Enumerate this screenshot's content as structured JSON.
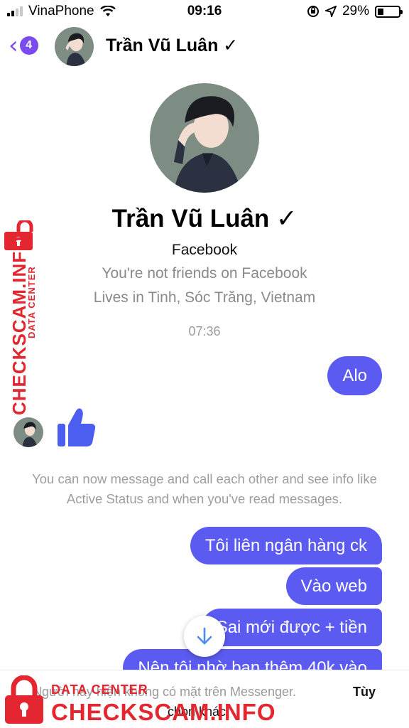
{
  "status_bar": {
    "carrier": "VinaPhone",
    "time": "09:16",
    "battery_percent": "29%",
    "battery_level": 0.29
  },
  "header": {
    "unread_count": "4",
    "name": "Trần Vũ Luân ✓"
  },
  "profile": {
    "name": "Trần Vũ Luân ✓",
    "subtitle": "Facebook",
    "friend_status": "You're not friends on Facebook",
    "location": "Lives in Tinh, Sóc Trăng, Vietnam"
  },
  "conversation": {
    "timestamp": "07:36",
    "first_sent": "Alo",
    "info_text": "You can now message and call each other and see info like Active Status and when you've read messages.",
    "sent_messages": [
      "Tôi liên ngân hàng ck",
      "Vào web",
      "Sai mới được + tiền",
      "Nên tôi nhờ bạn thêm 40k vào"
    ]
  },
  "bottom_bar": {
    "notice": "Người này hiện không có mặt trên Messenger.",
    "option_label": "Tùy",
    "option_label_2": "chọn khác"
  },
  "watermark": {
    "brand": "CHECKSCAM.INFO",
    "tagline": "DATA CENTER"
  },
  "colors": {
    "accent": "#7b4bf0",
    "bubble": "#5b5bf2",
    "watermark": "#e3262f"
  },
  "icons": [
    "back-chevron-icon",
    "wifi-icon",
    "orientation-lock-icon",
    "location-arrow-icon",
    "battery-icon",
    "thumbs-up-icon",
    "arrow-down-icon",
    "lock-icon"
  ]
}
